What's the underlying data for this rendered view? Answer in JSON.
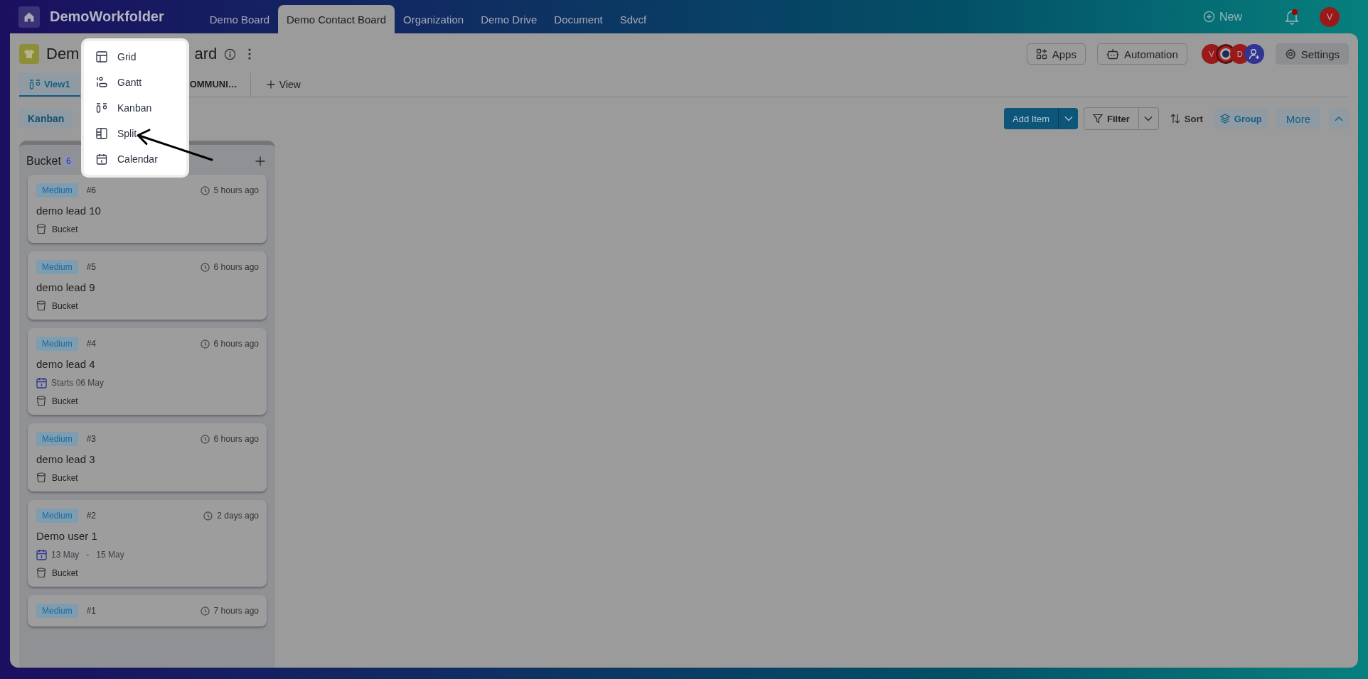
{
  "app": {
    "name": "DemoWorkfolder"
  },
  "nav_tabs": [
    {
      "label": "Demo Board",
      "selected": false
    },
    {
      "label": "Demo Contact Board",
      "selected": true
    },
    {
      "label": "Organization",
      "selected": false
    },
    {
      "label": "Demo Drive",
      "selected": false
    },
    {
      "label": "Document",
      "selected": false
    },
    {
      "label": "Sdvcf",
      "selected": false
    }
  ],
  "header_actions": {
    "new": "New",
    "notifications_unread": true,
    "user_initial": "V"
  },
  "board": {
    "title_start": "Dem",
    "title_end": "ard"
  },
  "toolbar_buttons": [
    {
      "kind": "apps",
      "label": "Apps"
    },
    {
      "kind": "automation",
      "label": "Automation"
    }
  ],
  "members": [
    {
      "kind": "initial",
      "label": "V",
      "color": "#9a1a1a"
    },
    {
      "kind": "picture"
    },
    {
      "kind": "initial",
      "label": "D",
      "color": "#9a1a1a"
    },
    {
      "kind": "add"
    }
  ],
  "settings": "Settings",
  "views": [
    {
      "label": "View1",
      "selected": true
    },
    {
      "label": "OMMUNI…",
      "selected": false
    }
  ],
  "add_view": "View",
  "group_chip": "Kanban",
  "actions": {
    "add_item": "Add Item",
    "filter": "Filter",
    "sort": "Sort",
    "group": "Group",
    "more": "More"
  },
  "column": {
    "title": "Bucket",
    "count": "6",
    "cards": [
      {
        "priority": "Medium",
        "number": "#6",
        "time": "5 hours ago",
        "title": "demo lead 10",
        "bucket": "Bucket"
      },
      {
        "priority": "Medium",
        "number": "#5",
        "time": "6 hours ago",
        "title": "demo lead 9",
        "bucket": "Bucket"
      },
      {
        "priority": "Medium",
        "number": "#4",
        "time": "6 hours ago",
        "title": "demo lead 4",
        "date": {
          "kind": "start",
          "text": "Starts 06 May"
        },
        "bucket": "Bucket"
      },
      {
        "priority": "Medium",
        "number": "#3",
        "time": "6 hours ago",
        "title": "demo lead 3",
        "bucket": "Bucket"
      },
      {
        "priority": "Medium",
        "number": "#2",
        "time": "2 days ago",
        "title": "Demo user 1",
        "date": {
          "kind": "range",
          "start": "13 May",
          "sep": "-",
          "end": "15 May"
        },
        "bucket": "Bucket"
      },
      {
        "priority": "Medium",
        "number": "#1",
        "time": "7 hours ago"
      }
    ]
  },
  "view_menu": {
    "items": [
      {
        "kind": "grid",
        "label": "Grid"
      },
      {
        "kind": "gantt",
        "label": "Gantt"
      },
      {
        "kind": "kanban",
        "label": "Kanban"
      },
      {
        "kind": "split",
        "label": "Split"
      },
      {
        "kind": "calendar",
        "label": "Calendar"
      }
    ]
  }
}
